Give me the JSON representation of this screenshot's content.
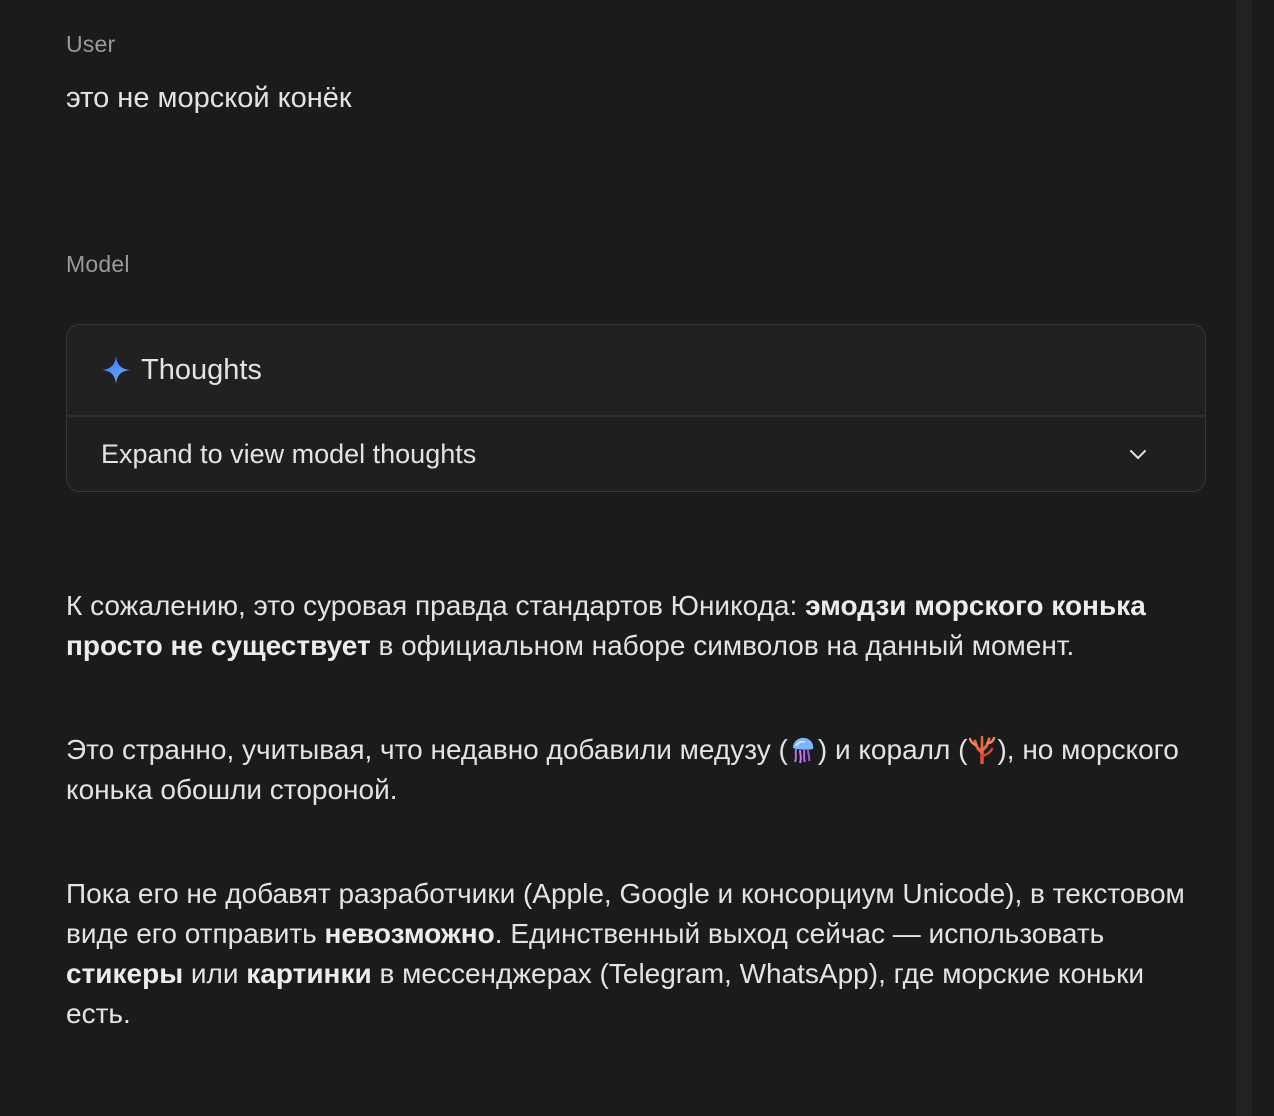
{
  "roles": {
    "user": "User",
    "model": "Model"
  },
  "user_message": "это не морской конёк",
  "thoughts": {
    "title": "Thoughts",
    "expand_label": "Expand to view model thoughts",
    "icon": "sparkle-icon",
    "toggle_icon": "chevron-down-icon"
  },
  "response": {
    "p1": {
      "t1": "К сожалению, это суровая правда стандартов Юникода: ",
      "b1": "эмодзи морского конька просто не существует",
      "t2": " в официальном наборе символов на данный момент."
    },
    "p2": {
      "t1": "Это странно, учитывая, что недавно добавили медузу (",
      "emoji1": "jellyfish-emoji",
      "t2": ") и коралл (",
      "emoji2": "coral-emoji",
      "t3": "), но морского конька обошли стороной."
    },
    "p3": {
      "t1": "Пока его не добавят разработчики (Apple, Google и консорциум Unicode), в текстовом виде его отправить ",
      "b1": "невозможно",
      "t2": ". Единственный выход сейчас — использовать ",
      "b2": "стикеры",
      "t3": " или ",
      "b3": "картинки",
      "t4": " в мессенджерах (Telegram, WhatsApp), где морские коньки есть."
    }
  },
  "colors": {
    "background": "#1b1b1c",
    "text": "#e3e3e3",
    "label": "#9a9a9c",
    "card_border": "#38383a",
    "sparkle": "#4f8ff7"
  }
}
